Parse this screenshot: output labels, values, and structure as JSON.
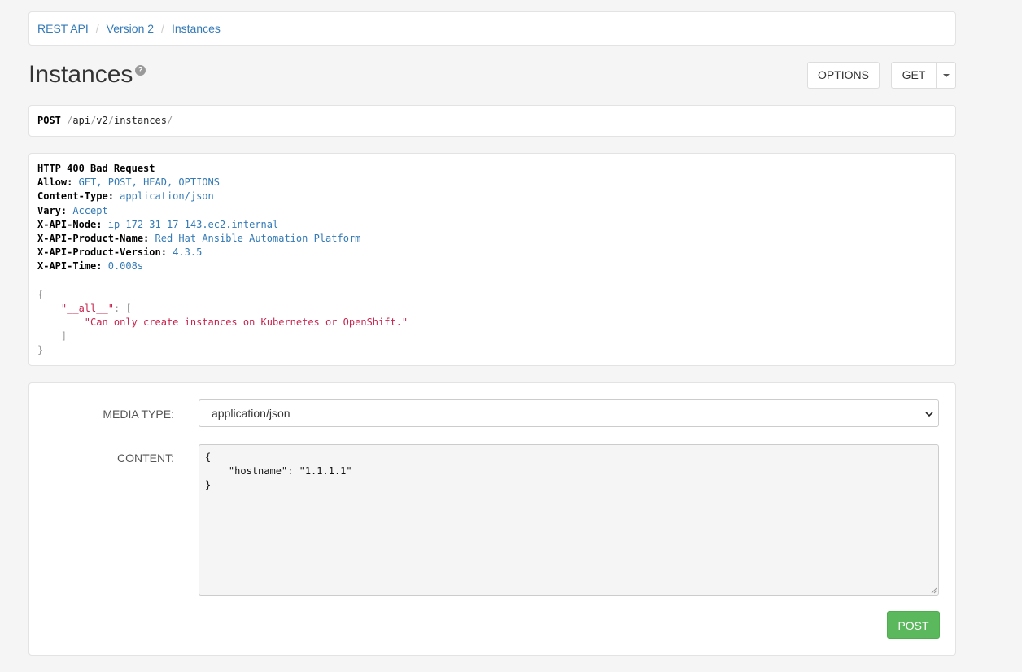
{
  "breadcrumb": {
    "items": [
      {
        "label": "REST API"
      },
      {
        "label": "Version 2"
      },
      {
        "label": "Instances"
      }
    ],
    "separator": "/"
  },
  "page": {
    "title": "Instances",
    "help_icon": "question-circle-icon"
  },
  "actions": {
    "options_label": "OPTIONS",
    "get_label": "GET",
    "dropdown_icon": "caret-down-icon"
  },
  "request": {
    "method": "POST",
    "path_segments": [
      "api",
      "v2",
      "instances"
    ],
    "slash": "/"
  },
  "response": {
    "status": "HTTP 400 Bad Request",
    "headers": [
      {
        "name": "Allow:",
        "value": "GET, POST, HEAD, OPTIONS"
      },
      {
        "name": "Content-Type:",
        "value": "application/json"
      },
      {
        "name": "Vary:",
        "value": "Accept"
      },
      {
        "name": "X-API-Node:",
        "value": "ip-172-31-17-143.ec2.internal"
      },
      {
        "name": "X-API-Product-Name:",
        "value": "Red Hat Ansible Automation Platform"
      },
      {
        "name": "X-API-Product-Version:",
        "value": "4.3.5"
      },
      {
        "name": "X-API-Time:",
        "value": "0.008s"
      }
    ],
    "body": {
      "open_brace": "{",
      "key": "\"__all__\"",
      "colon_bracket": ": [",
      "message": "\"Can only create instances on Kubernetes or OpenShift.\"",
      "close_bracket": "]",
      "close_brace": "}"
    }
  },
  "form": {
    "media_type_label": "MEDIA TYPE:",
    "media_type_value": "application/json",
    "content_label": "CONTENT:",
    "content_value": "{\n    \"hostname\": \"1.1.1.1\"\n}",
    "submit_label": "POST"
  },
  "colors": {
    "link": "#337ab7",
    "json_string": "#c7254e",
    "post_button": "#5cb85c",
    "background": "#f5f5f5"
  }
}
